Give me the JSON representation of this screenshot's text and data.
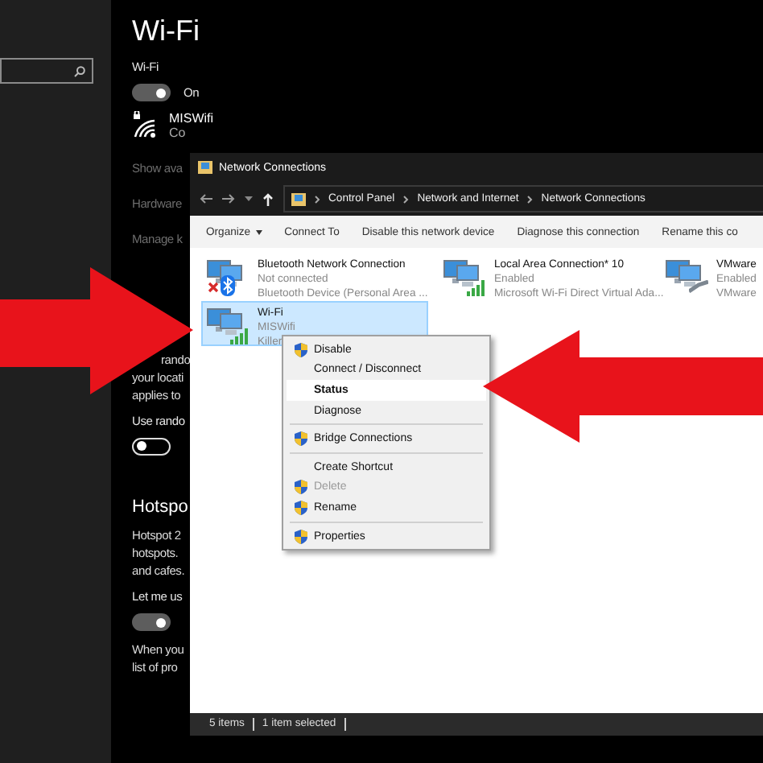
{
  "settings": {
    "title": "Wi-Fi",
    "sections": [
      {
        "blocks": [
          {
            "kind": "label",
            "text": "Wi-Fi"
          },
          {
            "kind": "toggle",
            "on": true,
            "text": "On"
          },
          {
            "kind": "network",
            "name": "MISWifi",
            "status": "Co"
          },
          {
            "kind": "link",
            "text": "Show ava"
          },
          {
            "kind": "link",
            "text": "Hardware"
          },
          {
            "kind": "link",
            "text": "Manage k"
          }
        ]
      },
      {
        "blocks": [
          {
            "kind": "text",
            "lines": [
              "rando",
              "your locati",
              "applies to"
            ]
          },
          {
            "kind": "label",
            "text": "Use rando"
          },
          {
            "kind": "toggle",
            "on": false
          }
        ]
      },
      {
        "blocks": [
          {
            "kind": "heading",
            "text": "Hotspo"
          },
          {
            "kind": "text",
            "lines": [
              "Hotspot 2",
              "hotspots.",
              "and cafes."
            ]
          },
          {
            "kind": "label",
            "text": "Let me us"
          },
          {
            "kind": "toggle",
            "on": true
          },
          {
            "kind": "text",
            "lines": [
              "When you",
              "list of pro"
            ]
          }
        ]
      }
    ]
  },
  "window": {
    "title": "Network Connections",
    "breadcrumbs": [
      "Control Panel",
      "Network and Internet",
      "Network Connections"
    ],
    "toolbar": [
      {
        "label": "Organize",
        "kind": "menu"
      },
      {
        "label": "Connect To",
        "kind": "button"
      },
      {
        "label": "Disable this network device",
        "kind": "button"
      },
      {
        "label": "Diagnose this connection",
        "kind": "button"
      },
      {
        "label": "Rename this co",
        "kind": "button"
      }
    ],
    "connections": [
      {
        "name": "Bluetooth Network Connection",
        "status": "Not connected",
        "device": "Bluetooth Device (Personal Area ...",
        "kind": "bluetooth",
        "disconnected": true,
        "selected": false
      },
      {
        "name": "Local Area Connection* 10",
        "status": "Enabled",
        "device": "Microsoft Wi-Fi Direct Virtual Ada...",
        "kind": "wireless",
        "disconnected": false,
        "selected": false
      },
      {
        "name": "VMware",
        "status": "Enabled",
        "device": "VMware",
        "kind": "ethernet",
        "disconnected": false,
        "selected": false
      },
      {
        "name": "Wi-Fi",
        "status": "MISWifi",
        "device": "Killer",
        "kind": "wireless",
        "disconnected": false,
        "selected": true
      }
    ],
    "status_bar": [
      "5 items",
      "1 item selected"
    ]
  },
  "context_menu": [
    {
      "kind": "item",
      "label": "Disable",
      "shield": true,
      "selected": false,
      "disabled": false
    },
    {
      "kind": "item",
      "label": "Connect / Disconnect",
      "shield": false,
      "selected": false,
      "disabled": false
    },
    {
      "kind": "item",
      "label": "Status",
      "shield": false,
      "selected": true,
      "disabled": false
    },
    {
      "kind": "item",
      "label": "Diagnose",
      "shield": false,
      "selected": false,
      "disabled": false
    },
    {
      "kind": "separator"
    },
    {
      "kind": "item",
      "label": "Bridge Connections",
      "shield": true,
      "selected": false,
      "disabled": false
    },
    {
      "kind": "separator"
    },
    {
      "kind": "item",
      "label": "Create Shortcut",
      "shield": false,
      "selected": false,
      "disabled": false
    },
    {
      "kind": "item",
      "label": "Delete",
      "shield": true,
      "selected": false,
      "disabled": true
    },
    {
      "kind": "item",
      "label": "Rename",
      "shield": true,
      "selected": false,
      "disabled": false
    },
    {
      "kind": "separator"
    },
    {
      "kind": "item",
      "label": "Properties",
      "shield": true,
      "selected": false,
      "disabled": false
    }
  ]
}
